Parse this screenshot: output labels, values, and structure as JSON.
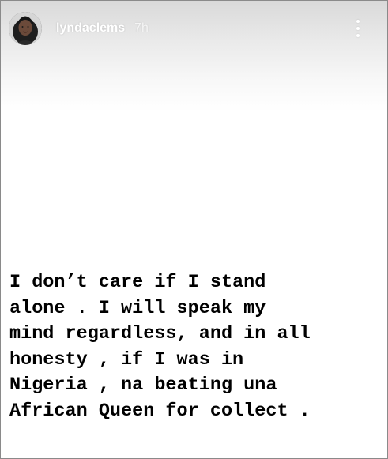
{
  "story": {
    "username": "lyndaclems",
    "timestamp": "7h",
    "more_icon": "more-vertical-icon",
    "text": "I don’t care if I stand\nalone . I will speak my\nmind regardless, and in all\nhonesty , if I was in\nNigeria , na beating una\nAfrican Queen for collect ."
  },
  "colors": {
    "background": "#ffffff",
    "text": "#000000",
    "header_text": "#ffffff"
  }
}
